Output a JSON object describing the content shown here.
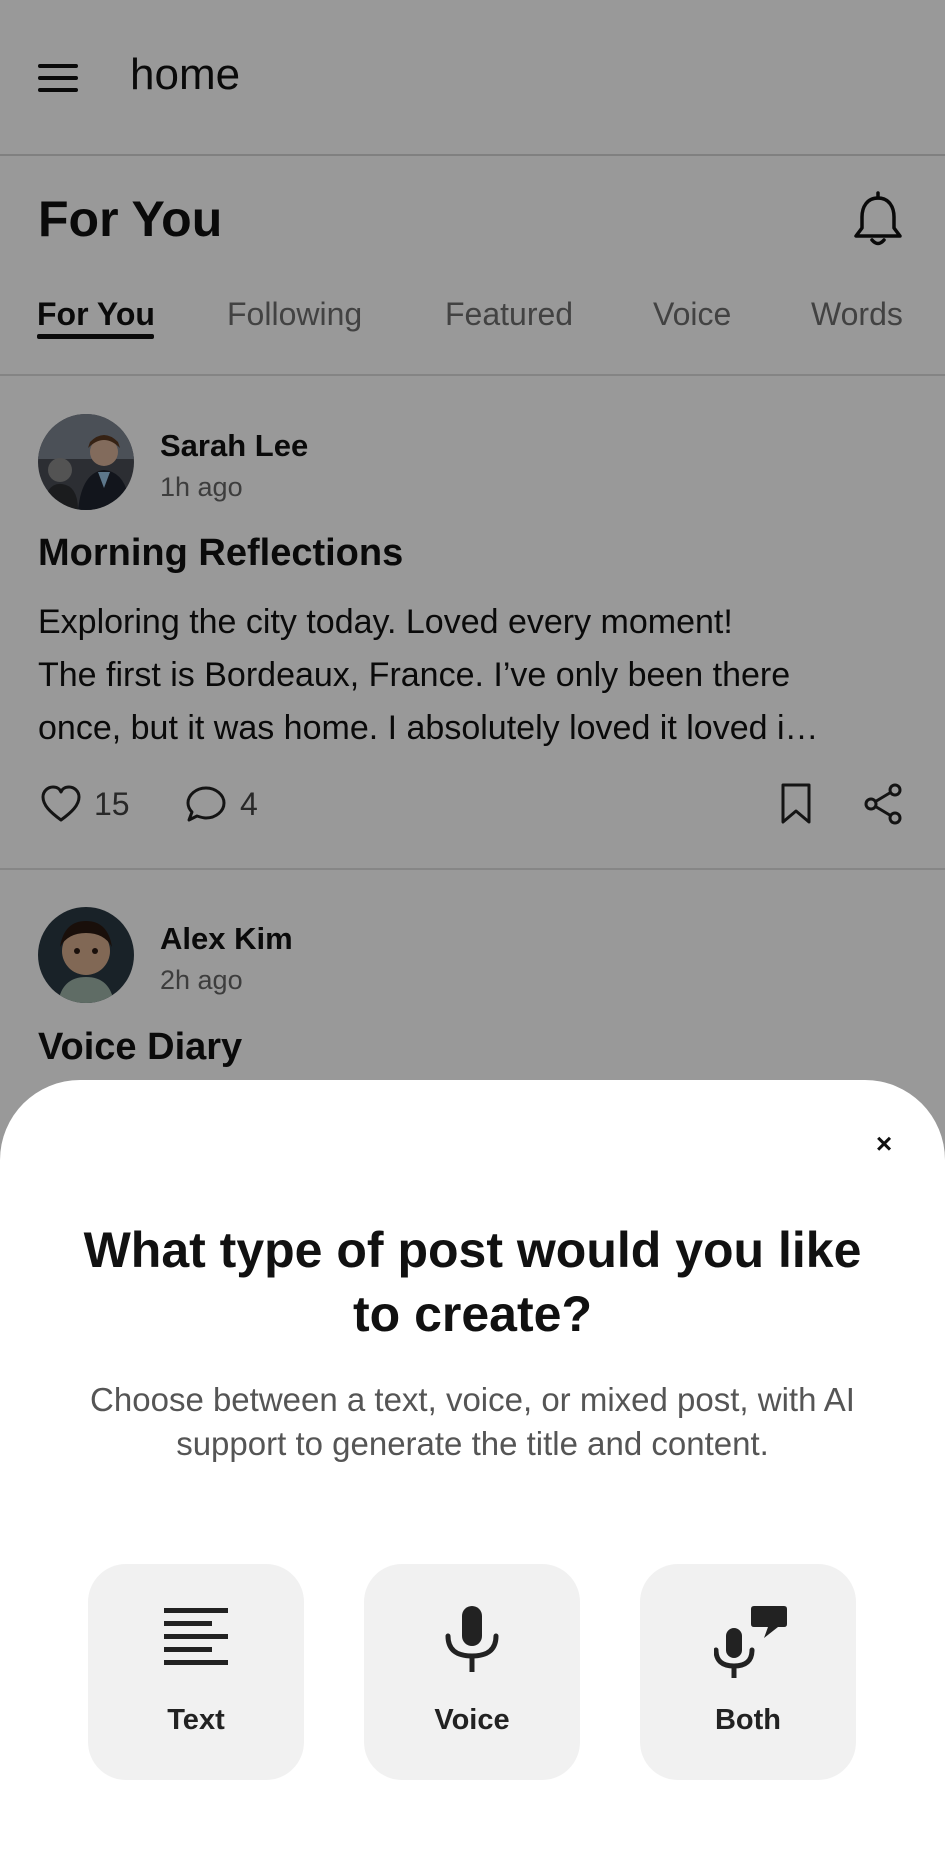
{
  "appbar": {
    "title": "home"
  },
  "header": {
    "title": "For You"
  },
  "tabs": [
    {
      "label": "For You",
      "active": true
    },
    {
      "label": "Following"
    },
    {
      "label": "Featured"
    },
    {
      "label": "Voice"
    },
    {
      "label": "Words"
    }
  ],
  "posts": [
    {
      "author": "Sarah Lee",
      "time": "1h ago",
      "title": "Morning Reflections",
      "body_lines": [
        "Exploring the city today. Loved every moment!",
        "The first is Bordeaux, France. I’ve only been there",
        "once, but it was home. I absolutely loved it loved i…"
      ],
      "likes": "15",
      "comments": "4"
    },
    {
      "author": "Alex Kim",
      "time": "2h ago",
      "title": "Voice Diary"
    }
  ],
  "sheet": {
    "close": "×",
    "title": "What type of post would you like to create?",
    "subtitle": "Choose between a text, voice, or mixed post, with AI support to generate the title and content.",
    "options": [
      {
        "label": "Text",
        "icon": "text-lines-icon"
      },
      {
        "label": "Voice",
        "icon": "microphone-icon"
      },
      {
        "label": "Both",
        "icon": "mic-with-speech-bubble-icon"
      }
    ]
  }
}
